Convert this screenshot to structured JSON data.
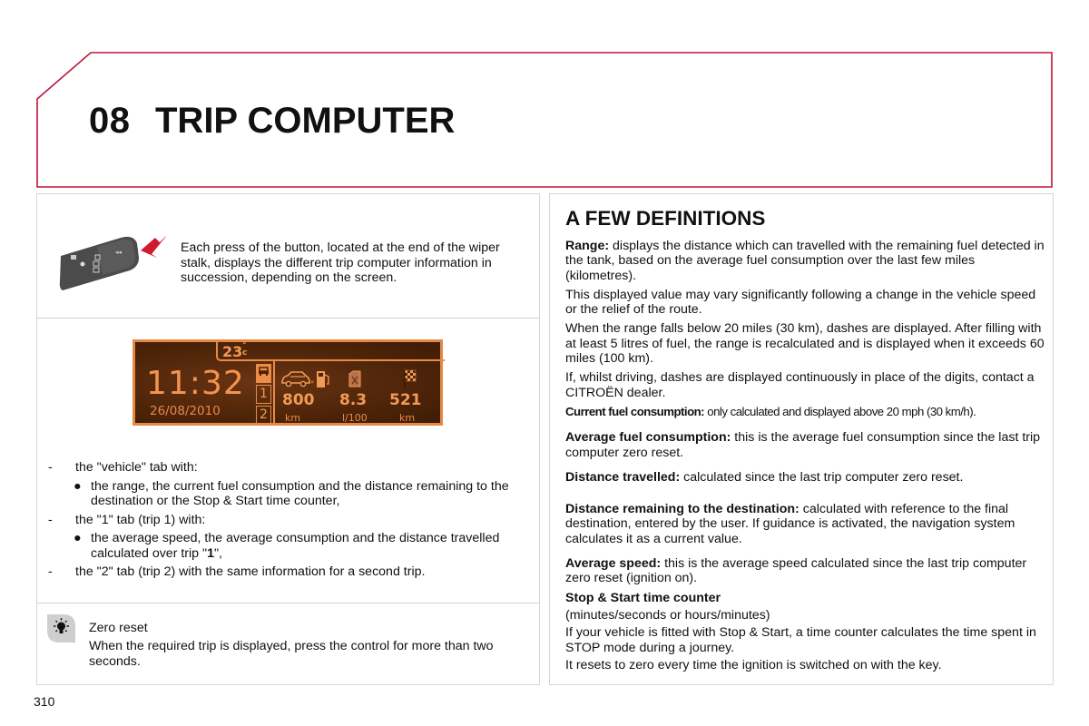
{
  "header": {
    "chapter_number": "08",
    "chapter_title": "TRIP COMPUTER",
    "border_color": "#c0143c"
  },
  "left": {
    "stalk": {
      "icon": "wiper-stalk-with-red-arrow",
      "text": "Each press of the button, located at the end of the wiper stalk, displays the different trip computer information in succession, depending on the screen."
    },
    "display": {
      "temperature": "23",
      "temperature_unit": "°C",
      "time": "11:32",
      "date": "26/08/2010",
      "tabs": [
        {
          "label": "vehicle",
          "icon": "car-icon",
          "active": true
        },
        {
          "label": "1",
          "active": false
        },
        {
          "label": "2",
          "active": false
        }
      ],
      "readings": [
        {
          "icon": "car-to-fuel-pump-icon",
          "value": "800",
          "unit": "km"
        },
        {
          "icon": "fuel-can-icon",
          "value": "8.3",
          "unit": "l/100"
        },
        {
          "icon": "checkered-flag-icon",
          "value": "521",
          "unit": "km"
        }
      ]
    },
    "list": [
      {
        "type": "dash",
        "marker": "-",
        "text": "the \"vehicle\" tab with:"
      },
      {
        "type": "bullet",
        "marker": "●",
        "text": "the range, the current fuel consumption and the distance remaining to the destination or the Stop & Start time counter,"
      },
      {
        "type": "dash",
        "marker": "-",
        "text": "the \"1\" tab (trip 1) with:"
      },
      {
        "type": "bullet",
        "marker": "●",
        "text_before": "the average speed, the average consumption and the distance travelled calculated over trip \"",
        "text_bold": "1",
        "text_after": "\","
      },
      {
        "type": "dash",
        "marker": "-",
        "text": "the \"2\" tab (trip 2) with the same information for a second trip."
      }
    ],
    "zero_reset": {
      "icon": "lightbulb-icon",
      "title": "Zero reset",
      "text": "When the required trip is displayed, press the control for more than two seconds."
    }
  },
  "right": {
    "title": "A FEW DEFINITIONS",
    "definitions": [
      {
        "term": "Range:",
        "text": " displays the distance which can travelled with the remaining fuel detected in the tank, based on the average fuel consumption over the last few miles (kilometres)."
      },
      {
        "term": "",
        "text": "This displayed value may vary significantly following a change in the vehicle speed or the relief of the route."
      },
      {
        "term": "",
        "text": "When the range falls below 20 miles (30 km), dashes are displayed. After filling with at least 5 litres of fuel, the range is recalculated and is displayed when it exceeds 60 miles (100 km)."
      },
      {
        "term": "",
        "text": "If, whilst driving, dashes are displayed continuously in place of the digits, contact a CITROËN dealer."
      },
      {
        "term": "Current fuel consumption:",
        "text": " only calculated and displayed above 20 mph (30 km/h)."
      },
      {
        "term": "Average fuel consumption:",
        "text": " this is the average fuel consumption since the last trip computer zero reset."
      },
      {
        "term": "Distance travelled:",
        "text": " calculated since the last trip computer zero reset."
      },
      {
        "term": "Distance remaining to the destination:",
        "text": " calculated with reference to the final destination, entered by the user. If guidance is activated, the navigation system calculates it as a current value."
      },
      {
        "term": "Average speed:",
        "text": " this is the average speed calculated since the last trip computer zero reset (ignition on)."
      },
      {
        "term": "Stop & Start time counter",
        "text": ""
      },
      {
        "term": "",
        "text": "(minutes/seconds or hours/minutes)"
      },
      {
        "term": "",
        "text": "If your vehicle is fitted with Stop & Start, a time counter calculates the time spent in STOP mode during a journey."
      },
      {
        "term": "",
        "text": "It resets to zero every time the ignition is switched on with the key."
      }
    ]
  },
  "footer": {
    "page_number": "310"
  }
}
